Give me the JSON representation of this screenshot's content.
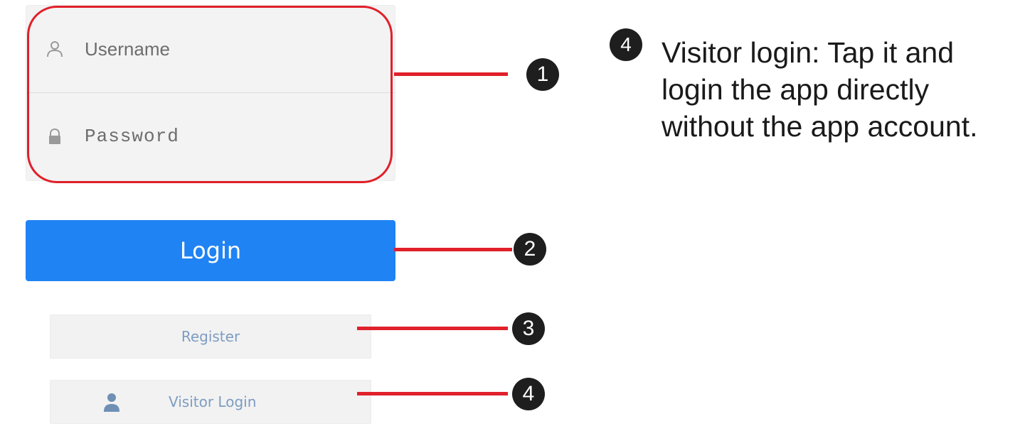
{
  "login_form": {
    "username_placeholder": "Username",
    "password_placeholder": "Password",
    "login_label": "Login",
    "register_label": "Register",
    "visitor_label": "Visitor Login"
  },
  "callouts": {
    "badge_1": "1",
    "badge_2": "2",
    "badge_3": "3",
    "badge_4": "4"
  },
  "note": {
    "badge": "4",
    "lines": [
      "Visitor login: Tap it and",
      "login the app directly",
      "without the app account."
    ]
  },
  "colors": {
    "accent_blue": "#1f83f4",
    "callout_red": "#e0202a",
    "badge_dark": "#1e1e1e"
  },
  "icons": {
    "username": "user-outline-icon",
    "password": "lock-icon",
    "visitor": "visitor-person-icon"
  }
}
